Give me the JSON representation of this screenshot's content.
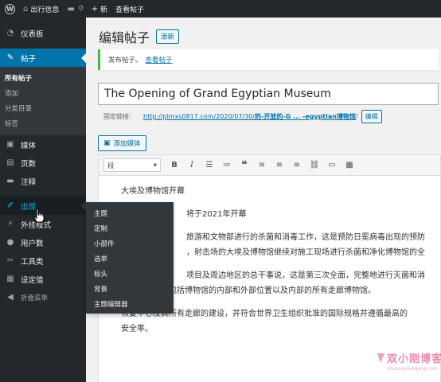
{
  "adminbar": {
    "site_name": "出行信息",
    "comments_count": "0",
    "new_label": "新",
    "view_post": "查看帖子"
  },
  "sidebar": {
    "dashboard": "仪表板",
    "posts": "帖子",
    "posts_sub": [
      "所有帖子",
      "添加",
      "分类目录",
      "标签"
    ],
    "media": "媒体",
    "pages": "页数",
    "comments": "注释",
    "appearance": "出现",
    "plugins": "外挂程式",
    "users": "用户数",
    "tools": "工具类",
    "settings": "设定值",
    "collapse": "折叠菜单"
  },
  "flyout": [
    "主题",
    "定制",
    "小部件",
    "选单",
    "标头",
    "背景",
    "主题编辑器"
  ],
  "main": {
    "page_title": "编辑帖子",
    "add_new": "添新",
    "notice_text": "发布帖子。",
    "notice_link": "查看帖子",
    "post_title": "The Opening of Grand Egyptian Museum",
    "permalink_label": "固定链接：",
    "permalink_url": "http://plmxs0817.com/2020/07/30/",
    "permalink_slug": "的-开放的-G ... -egyptian博物馆",
    "permalink_tail": "/",
    "edit_button": "编辑",
    "add_media": "添加媒体",
    "format_select": "段"
  },
  "content": {
    "p1": "大埃及博物馆开幕",
    "p2": "将于2021年开幕",
    "p3_lines": [
      "旅游和文物部进行的杀菌和消毒工作，这是预防日冕病毒出现的预防",
      "，射击场的大埃及博物馆继续对施工现场进行杀菌和净化博物馆的全"
    ],
    "p4_lines": [
      "项目及周边地区的总干事说，这是第三次全面，完整地进行灭菌和消",
      "毒工作，其中包括博物馆的内部和外部位置以及内部的所有走廊博物馆。"
    ],
    "p5_lines": [
      "恢复中心及其所有走廊的建设，并符合世界卫生组织批准的国际规格并遵循最高的",
      "安全率。"
    ]
  },
  "watermark": {
    "text": "双小刚博客",
    "sub": "shuangxiaogang.com"
  },
  "colors": {
    "admin_dark": "#23282d",
    "accent": "#0073aa",
    "notice_green": "#46b450"
  }
}
